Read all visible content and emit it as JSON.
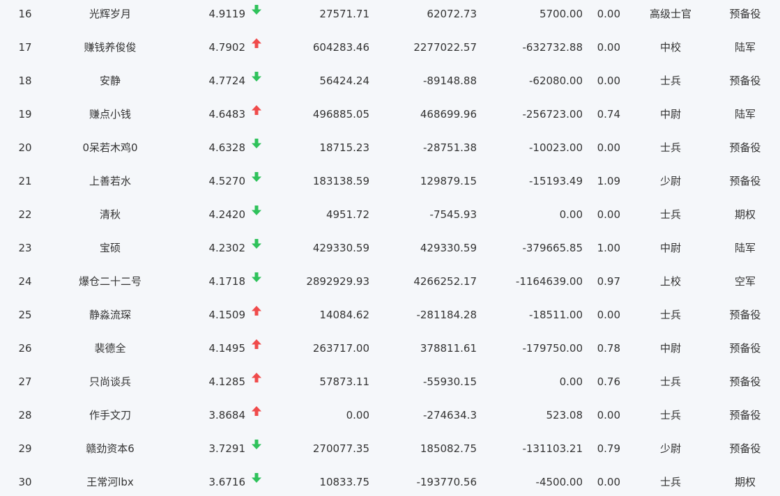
{
  "colors": {
    "up": "#f04b4b",
    "down": "#2fc25b",
    "text": "#333333",
    "background": "#f5f7fa"
  },
  "rows": [
    {
      "rank": "16",
      "name": "光辉岁月",
      "score": "4.9119",
      "trend": "down",
      "v1": "27571.71",
      "v2": "62072.73",
      "v3": "5700.00",
      "ratio": "0.00",
      "title": "高级士官",
      "type": "预备役"
    },
    {
      "rank": "17",
      "name": "赚钱养俊俊",
      "score": "4.7902",
      "trend": "up",
      "v1": "604283.46",
      "v2": "2277022.57",
      "v3": "-632732.88",
      "ratio": "0.00",
      "title": "中校",
      "type": "陆军"
    },
    {
      "rank": "18",
      "name": "安静",
      "score": "4.7724",
      "trend": "down",
      "v1": "56424.24",
      "v2": "-89148.88",
      "v3": "-62080.00",
      "ratio": "0.00",
      "title": "士兵",
      "type": "预备役"
    },
    {
      "rank": "19",
      "name": "赚点小钱",
      "score": "4.6483",
      "trend": "up",
      "v1": "496885.05",
      "v2": "468699.96",
      "v3": "-256723.00",
      "ratio": "0.74",
      "title": "中尉",
      "type": "陆军"
    },
    {
      "rank": "20",
      "name": "0呆若木鸡0",
      "score": "4.6328",
      "trend": "down",
      "v1": "18715.23",
      "v2": "-28751.38",
      "v3": "-10023.00",
      "ratio": "0.00",
      "title": "士兵",
      "type": "预备役"
    },
    {
      "rank": "21",
      "name": "上善若水",
      "score": "4.5270",
      "trend": "down",
      "v1": "183138.59",
      "v2": "129879.15",
      "v3": "-15193.49",
      "ratio": "1.09",
      "title": "少尉",
      "type": "预备役"
    },
    {
      "rank": "22",
      "name": "清秋",
      "score": "4.2420",
      "trend": "down",
      "v1": "4951.72",
      "v2": "-7545.93",
      "v3": "0.00",
      "ratio": "0.00",
      "title": "士兵",
      "type": "期权"
    },
    {
      "rank": "23",
      "name": "宝硕",
      "score": "4.2302",
      "trend": "down",
      "v1": "429330.59",
      "v2": "429330.59",
      "v3": "-379665.85",
      "ratio": "1.00",
      "title": "中尉",
      "type": "陆军"
    },
    {
      "rank": "24",
      "name": "爆仓二十二号",
      "score": "4.1718",
      "trend": "down",
      "v1": "2892929.93",
      "v2": "4266252.17",
      "v3": "-1164639.00",
      "ratio": "0.97",
      "title": "上校",
      "type": "空军"
    },
    {
      "rank": "25",
      "name": "静淼流琛",
      "score": "4.1509",
      "trend": "up",
      "v1": "14084.62",
      "v2": "-281184.28",
      "v3": "-18511.00",
      "ratio": "0.00",
      "title": "士兵",
      "type": "预备役"
    },
    {
      "rank": "26",
      "name": "裴德全",
      "score": "4.1495",
      "trend": "up",
      "v1": "263717.00",
      "v2": "378811.61",
      "v3": "-179750.00",
      "ratio": "0.78",
      "title": "中尉",
      "type": "预备役"
    },
    {
      "rank": "27",
      "name": "只尚谈兵",
      "score": "4.1285",
      "trend": "up",
      "v1": "57873.11",
      "v2": "-55930.15",
      "v3": "0.00",
      "ratio": "0.76",
      "title": "士兵",
      "type": "预备役"
    },
    {
      "rank": "28",
      "name": "作手文刀",
      "score": "3.8684",
      "trend": "up",
      "v1": "0.00",
      "v2": "-274634.3",
      "v3": "523.08",
      "ratio": "0.00",
      "title": "士兵",
      "type": "预备役"
    },
    {
      "rank": "29",
      "name": "赣劲资本6",
      "score": "3.7291",
      "trend": "down",
      "v1": "270077.35",
      "v2": "185082.75",
      "v3": "-131103.21",
      "ratio": "0.79",
      "title": "少尉",
      "type": "预备役"
    },
    {
      "rank": "30",
      "name": "王常河lbx",
      "score": "3.6716",
      "trend": "down",
      "v1": "10833.75",
      "v2": "-193770.56",
      "v3": "-4500.00",
      "ratio": "0.00",
      "title": "士兵",
      "type": "期权"
    }
  ]
}
